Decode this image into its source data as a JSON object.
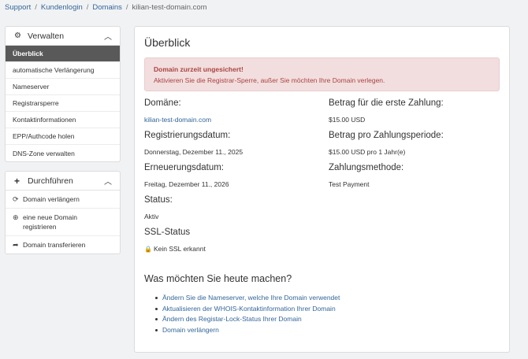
{
  "breadcrumb": {
    "items": [
      "Support",
      "Kundenlogin",
      "Domains",
      "kilian-test-domain.com"
    ],
    "separator": "/"
  },
  "manage_panel": {
    "title": "Verwalten",
    "icon": "gear-icon",
    "items": [
      "Überblick",
      "automatische Verlängerung",
      "Nameserver",
      "Registrarsperre",
      "Kontaktinformationen",
      "EPP/Authcode holen",
      "DNS-Zone verwalten"
    ],
    "active_index": 0
  },
  "actions_panel": {
    "title": "Durchführen",
    "icon": "plus-icon",
    "items": [
      {
        "label": "Domain verlängern",
        "icon": "refresh-icon"
      },
      {
        "label": "eine neue Domain registrieren",
        "icon": "globe-icon"
      },
      {
        "label": "Domain transferieren",
        "icon": "share-icon"
      }
    ]
  },
  "main": {
    "title": "Überblick",
    "alert": {
      "heading": "Domain zurzeit ungesichert!",
      "message": "Aktivieren Sie die Registrar-Sperre, außer Sie möchten Ihre Domain verlegen."
    },
    "left_fields": [
      {
        "label": "Domäne:",
        "value": "kilian-test-domain.com",
        "is_link": true
      },
      {
        "label": "Registrierungsdatum:",
        "value": "Donnerstag, Dezember 11., 2025"
      },
      {
        "label": "Erneuerungsdatum:",
        "value": "Freitag, Dezember 11., 2026"
      },
      {
        "label": "Status:",
        "value": "Aktiv"
      },
      {
        "label": "SSL-Status",
        "value": "Kein SSL erkannt",
        "icon": "lock-icon"
      }
    ],
    "right_fields": [
      {
        "label": "Betrag für die erste Zahlung:",
        "value": "$15.00 USD"
      },
      {
        "label": "Betrag pro Zahlungsperiode:",
        "value": "$15.00 USD pro 1 Jahr(e)"
      },
      {
        "label": "Zahlungsmethode:",
        "value": "Test Payment"
      }
    ],
    "actions_title": "Was möchten Sie heute machen?",
    "actions": [
      "Ändern Sie die Nameserver, welche Ihre Domain verwendet",
      "Aktualisieren der WHOIS-Kontaktinformation Ihrer Domain",
      "Ändern des Registar-Lock-Status Ihrer Domain",
      "Domain verlängern"
    ]
  },
  "colors": {
    "link": "#336699",
    "active_menu_bg": "#595959",
    "alert_bg": "#f2dede",
    "alert_text": "#a94442",
    "page_bg": "#f1f2f4"
  }
}
